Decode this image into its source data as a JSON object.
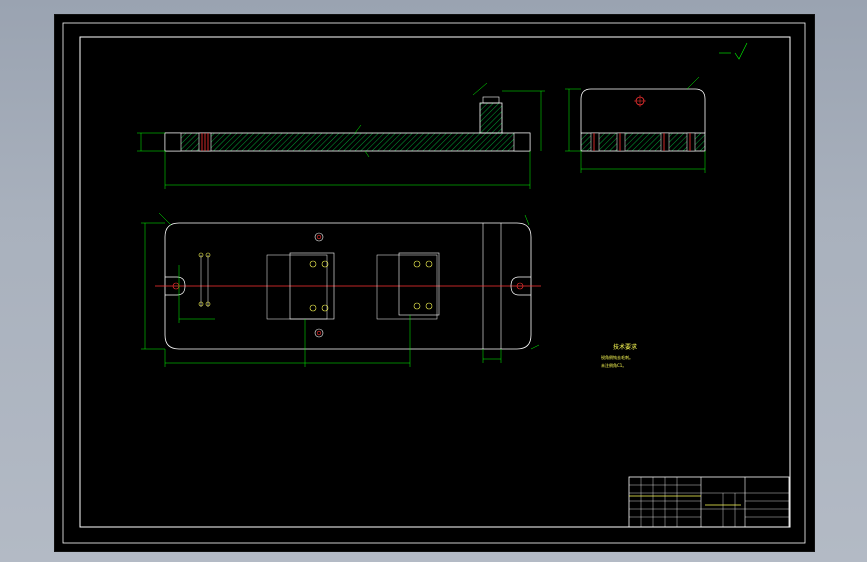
{
  "colors": {
    "background": "#000000",
    "frame": "#ffffff",
    "dimension": "#00ff00",
    "centerline": "#ff0000",
    "note": "#ffff55",
    "hatch": "#00ff00"
  },
  "drawing": {
    "tech_requirements": {
      "title": "技术要求",
      "lines": [
        "锐角倒钝去毛刺。",
        "未注倒角C1。"
      ]
    }
  }
}
